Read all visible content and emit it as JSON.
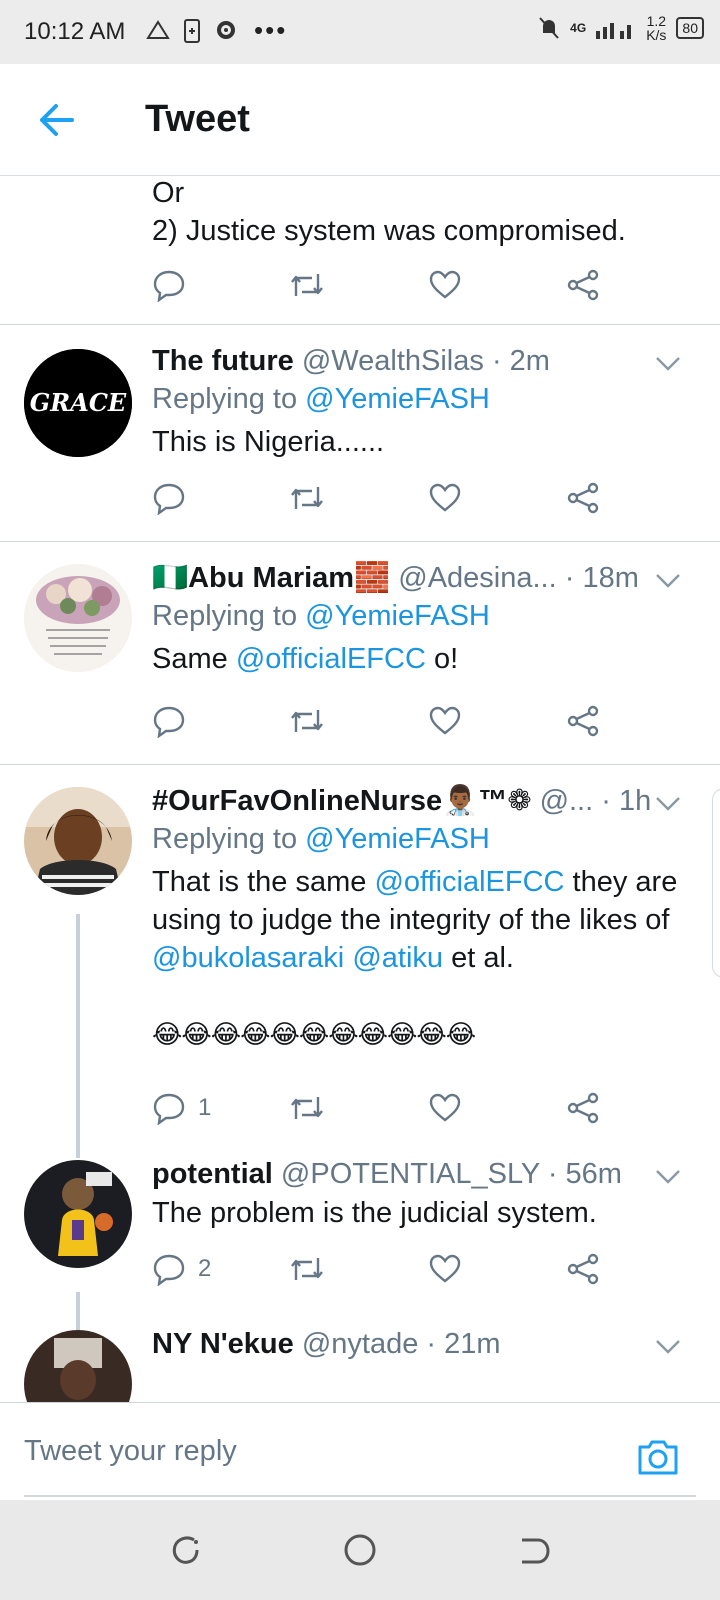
{
  "status_bar": {
    "time": "10:12 AM",
    "network": "4G",
    "speed_value": "1.2",
    "speed_unit": "K/s",
    "battery": "80"
  },
  "header": {
    "title": "Tweet"
  },
  "tweets": [
    {
      "text_lines": [
        "Or",
        "2) Justice system was compromised."
      ]
    },
    {
      "name": "The future",
      "handle": "@WealthSilas",
      "time": "· 2m",
      "replying_prefix": "Replying to ",
      "replying_to": "@YemieFASH",
      "text": "This is Nigeria......",
      "avatar_label": "GRACE"
    },
    {
      "name": "🇳🇬Abu Mariam🧱",
      "handle": "@Adesina...",
      "time": "· 18m",
      "replying_prefix": "Replying to ",
      "replying_to": "@YemieFASH",
      "text_before": "Same ",
      "text_link": "@officialEFCC",
      "text_after": " o!"
    },
    {
      "name": "#OurFavOnlineNurse👨🏾‍⚕️™❁",
      "handle": "@...",
      "time": "· 1h",
      "replying_prefix": "Replying to ",
      "replying_to": "@YemieFASH",
      "t1": "That is the same ",
      "t1_link": "@officialEFCC",
      "t1_after": " they are",
      "t2": "using to judge the integrity of the likes of",
      "t3_link_a": "@bukolasaraki",
      "t3_space": " ",
      "t3_link_b": "@atiku",
      "t3_after": " et al.",
      "emoji": "😂😂😂😂😂😂😂😂😂😂😂",
      "reply_count": "1"
    },
    {
      "name": "potential",
      "handle": "@POTENTIAL_SLY",
      "time": "· 56m",
      "text": "The problem is the judicial system.",
      "reply_count": "2"
    },
    {
      "name": "NY N'ekue",
      "handle": "@nytade",
      "time": "· 21m"
    }
  ],
  "reply_bar": {
    "placeholder": "Tweet your reply"
  },
  "colors": {
    "accent": "#1b95e0",
    "text": "#14171a",
    "muted": "#657786"
  },
  "icons": [
    "back-arrow-icon",
    "reply-icon",
    "retweet-icon",
    "like-icon",
    "share-icon",
    "chevron-down-icon",
    "camera-icon"
  ]
}
